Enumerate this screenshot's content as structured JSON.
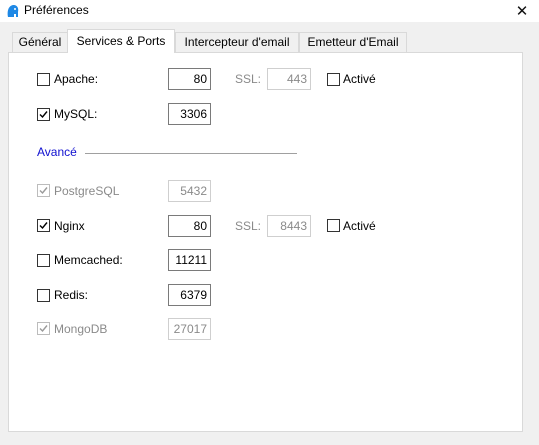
{
  "window": {
    "title": "Préférences",
    "close_glyph": "✕"
  },
  "tabs": [
    {
      "label": "Général",
      "active": false
    },
    {
      "label": "Services & Ports",
      "active": true
    },
    {
      "label": "Intercepteur d'email",
      "active": false
    },
    {
      "label": "Emetteur d'Email",
      "active": false
    }
  ],
  "services": {
    "apache": {
      "label": "Apache:",
      "checked": false,
      "port": "80",
      "ssl_label": "SSL:",
      "ssl_port": "443",
      "enabled_label": "Activé",
      "enabled_checked": false
    },
    "mysql": {
      "label": "MySQL:",
      "checked": true,
      "port": "3306"
    }
  },
  "advanced": {
    "title": "Avancé",
    "postgresql": {
      "label": "PostgreSQL",
      "checked": true,
      "disabled": true,
      "port": "5432"
    },
    "nginx": {
      "label": "Nginx",
      "checked": true,
      "port": "80",
      "ssl_label": "SSL:",
      "ssl_port": "8443",
      "enabled_label": "Activé",
      "enabled_checked": false
    },
    "memcached": {
      "label": "Memcached:",
      "checked": false,
      "port": "11211"
    },
    "redis": {
      "label": "Redis:",
      "checked": false,
      "port": "6379"
    },
    "mongodb": {
      "label": "MongoDB",
      "checked": true,
      "disabled": true,
      "port": "27017"
    }
  },
  "colors": {
    "accent": "#1010d0",
    "disabled_text": "#8a8a8a"
  },
  "icons": {
    "app": "elephant-icon",
    "check": "check-icon"
  }
}
